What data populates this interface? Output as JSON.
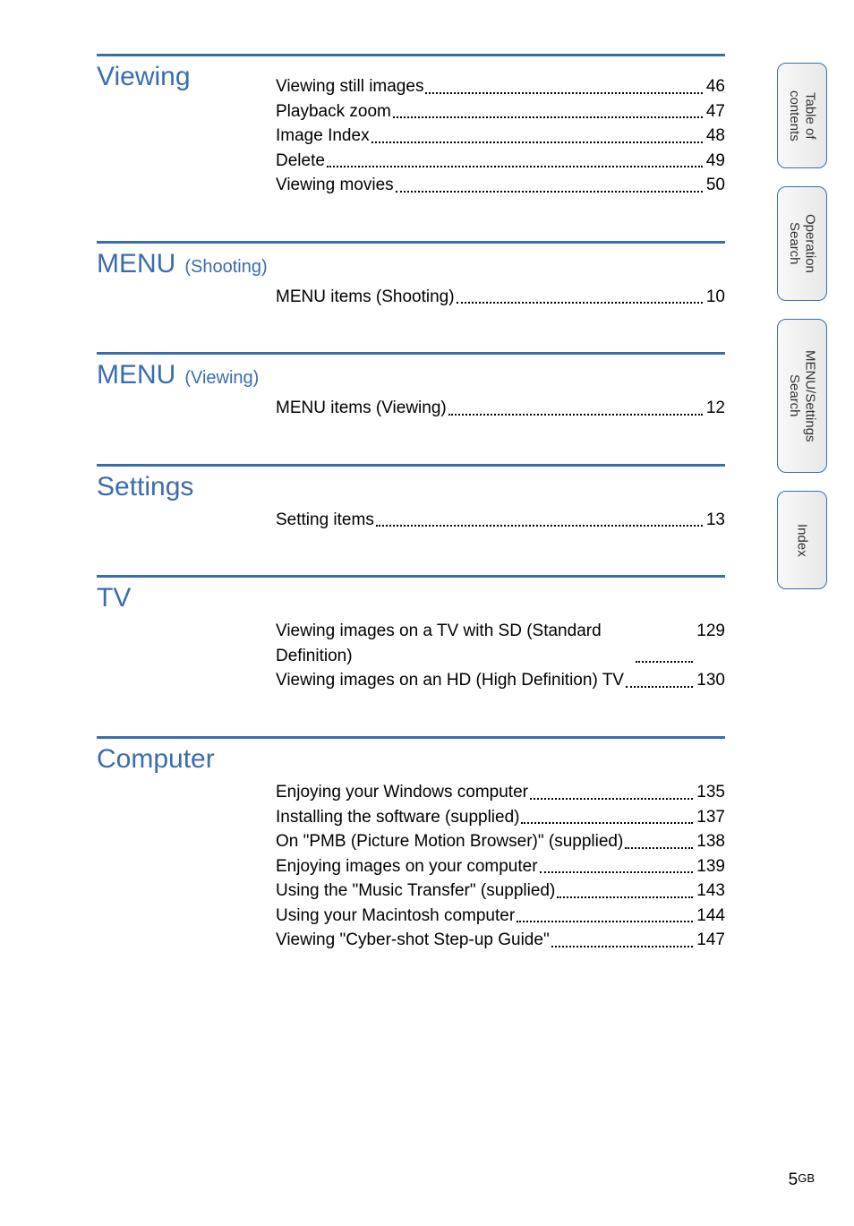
{
  "sections": [
    {
      "title": "Viewing",
      "sub": "",
      "items": [
        {
          "label": "Viewing still images",
          "page": "46"
        },
        {
          "label": "Playback zoom",
          "page": "47"
        },
        {
          "label": "Image Index",
          "page": "48"
        },
        {
          "label": "Delete",
          "page": "49"
        },
        {
          "label": "Viewing movies",
          "page": "50"
        }
      ]
    },
    {
      "title": "MENU",
      "sub": "(Shooting)",
      "items": [
        {
          "label": "MENU items (Shooting)",
          "page": "10"
        }
      ]
    },
    {
      "title": "MENU",
      "sub": "(Viewing)",
      "items": [
        {
          "label": "MENU items (Viewing)",
          "page": "12"
        }
      ]
    },
    {
      "title": "Settings",
      "sub": "",
      "items": [
        {
          "label": "Setting items",
          "page": "13"
        }
      ]
    },
    {
      "title": "TV",
      "sub": "",
      "items": [
        {
          "label": "Viewing images on a TV with SD (Standard Definition)",
          "page": "129"
        },
        {
          "label": "Viewing images on an HD (High Definition) TV",
          "page": "130"
        }
      ]
    },
    {
      "title": "Computer",
      "sub": "",
      "items": [
        {
          "label": "Enjoying your Windows computer",
          "page": "135"
        },
        {
          "label": "Installing the software (supplied)",
          "page": "137"
        },
        {
          "label": "On \"PMB (Picture Motion Browser)\" (supplied)",
          "page": "138"
        },
        {
          "label": "Enjoying images on your computer",
          "page": "139"
        },
        {
          "label": "Using the \"Music Transfer\" (supplied)",
          "page": "143"
        },
        {
          "label": "Using your Macintosh computer",
          "page": "144"
        },
        {
          "label": "Viewing \"Cyber-shot Step-up Guide\"",
          "page": "147"
        }
      ]
    }
  ],
  "sidebar": {
    "tabs": [
      {
        "label": "Table of\ncontents",
        "name": "tab-table-of-contents"
      },
      {
        "label": "Operation\nSearch",
        "name": "tab-operation-search"
      },
      {
        "label": "MENU/Settings\nSearch",
        "name": "tab-menu-settings-search"
      },
      {
        "label": "Index",
        "name": "tab-index"
      }
    ]
  },
  "footer": {
    "pageNumber": "5",
    "pageSuffix": "GB"
  }
}
